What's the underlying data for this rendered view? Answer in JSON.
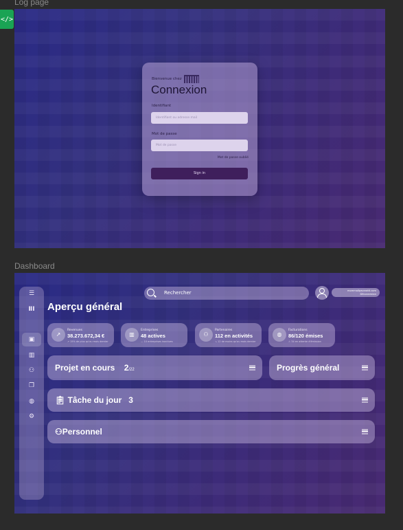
{
  "frames": {
    "login_label": "Log page",
    "dashboard_label": "Dashboard",
    "code_tab": "</>"
  },
  "login": {
    "welcome": "Bienvenue chez",
    "title": "Connexion",
    "identifier_label": "Identifiant",
    "identifier_placeholder": "Identifiant ou adresse mail",
    "password_label": "Mot de passe",
    "password_placeholder": "Mot de passe",
    "forgot": "Mot de passe oublié",
    "sign_in": "Sign in"
  },
  "dashboard": {
    "search_placeholder": "Rechercher",
    "user_email": "mommailpavarotti.com",
    "user_action": "Déconnexion",
    "page_title": "Aperçu général",
    "stats": [
      {
        "label": "Revenues",
        "value": "38.273.672,34 €",
        "sub": "↗ 15% de plus qu'au mois dernier",
        "icon": "trend-icon"
      },
      {
        "label": "Entreprises",
        "value": "48 actives",
        "sub": "— 10 entreprises inactives",
        "icon": "building-icon"
      },
      {
        "label": "Partenaires",
        "value": "112 en activités",
        "sub": "↘ 12 de moins qu'au mois dernier",
        "icon": "people-icon"
      },
      {
        "label": "Facturations",
        "value": "86/120 émises",
        "sub": "⚠ 34 en attente d'émission",
        "icon": "wallet-icon"
      }
    ],
    "cards": {
      "projects_title": "Projet en cours",
      "projects_count": "2",
      "projects_total": "/22",
      "progress_title": "Progrès général",
      "tasks_title": "Tâche du jour",
      "tasks_count": "3",
      "staff_title": "Personnel"
    }
  },
  "colors": {
    "background": "#2b2b2b",
    "accent": "#3f1f5c",
    "code_tab": "#1aa354"
  }
}
